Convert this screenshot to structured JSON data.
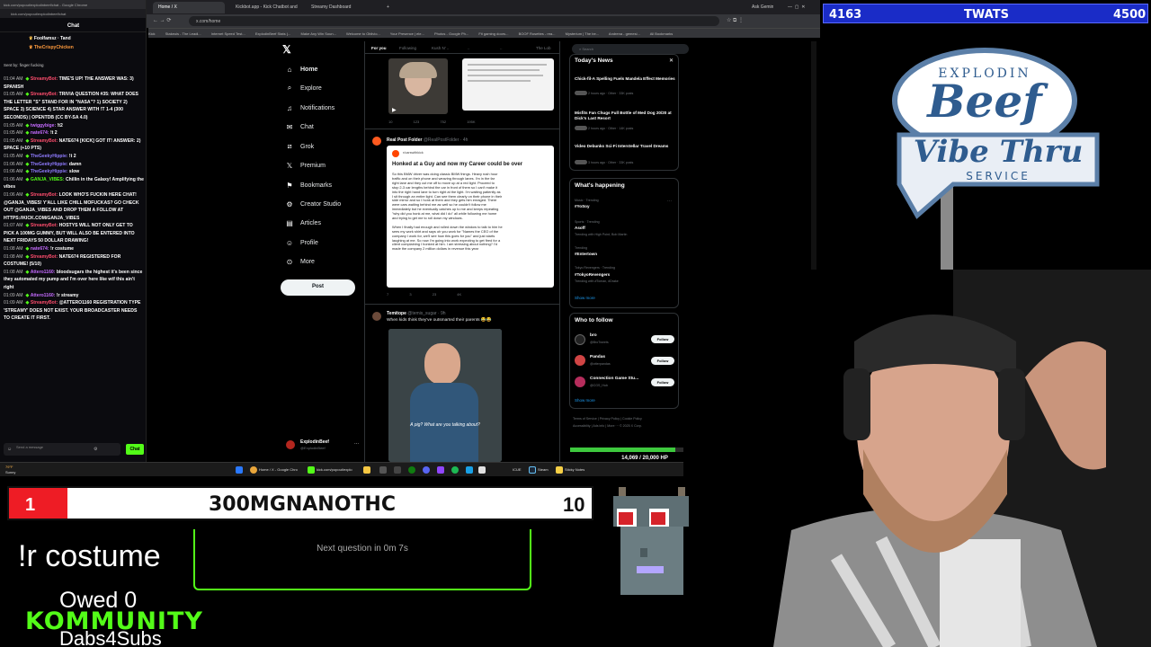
{
  "browser": {
    "tabs": [
      "Home / X",
      "Kickbot.app - Kick Chatbot and",
      "Streamy Dashboard"
    ],
    "url": "x.com/home",
    "bookmarks": [
      "Kick",
      "Stakeuis - The Leadi...",
      "Internet Speed Test...",
      "ExplodinBeef Stats (...",
      "Make Any Win Soun...",
      "Welcome to Oblivio...",
      "Your Presence | ele...",
      "Photos - Google Ph...",
      "Fit gaming doors...",
      "BOOF Rosettes - rea...",
      "Mysterium | The be...",
      "Andrena - gemesi...",
      "All Bookmarks"
    ],
    "gemini_label": "Ask Gemini"
  },
  "chat": {
    "window_title": "kick.com/popout/explodinbeef/chat - Google Chrome",
    "url": "kick.com/popout/explodinbeef/chat",
    "header": "Chat",
    "pinned": [
      {
        "user": "Foolfamsz",
        "text": "Tand"
      },
      {
        "user": "TheCrispyChicken",
        "text": ""
      }
    ],
    "pinned_note": "Sent by: finger fucking",
    "messages": [
      {
        "time": "01:04 AM",
        "user": "StreamyBot:",
        "type": "bot",
        "text": "TIME'S UP! THE ANSWER WAS: 3) SPANISH"
      },
      {
        "time": "01:05 AM",
        "user": "StreamyBot:",
        "type": "bot",
        "text": "TRIVIA QUESTION #35: WHAT DOES THE LETTER \"S\" STAND FOR IN \"NASA\"? 1) SOCIETY 2) SPACE 3) SCIENCE 4) STAR ANSWER WITH !T 1-4 (300 SECONDS) | OPENTDB (CC BY-SA 4.0)"
      },
      {
        "time": "01:05 AM",
        "user": "twiggybige:",
        "type": "user",
        "text": "!t2"
      },
      {
        "time": "01:05 AM",
        "user": "nate674:",
        "type": "user",
        "text": "!t 2"
      },
      {
        "time": "01:05 AM",
        "user": "StreamyBot:",
        "type": "bot",
        "text": "NATE674 [KICK] GOT IT! ANSWER: 2) SPACE (+10 PTS)"
      },
      {
        "time": "01:05 AM",
        "user": "TheGeekyHippie:",
        "type": "cyan",
        "text": "!t 2"
      },
      {
        "time": "01:06 AM",
        "user": "TheGeekyHippie:",
        "type": "cyan",
        "text": "damn"
      },
      {
        "time": "01:06 AM",
        "user": "TheGeekyHippie:",
        "type": "cyan",
        "text": "slow"
      },
      {
        "time": "01:06 AM",
        "user": "GANJA_VIBES:",
        "type": "green",
        "text": "Chillin in the Galaxy! Amplifying the vibes"
      },
      {
        "time": "01:06 AM",
        "user": "StreamyBot:",
        "type": "bot",
        "text": "LOOK WHO'S FUCKIN HERE CHAT! @GANJA_VIBES! Y'ALL LIKE CHILL MOFUCKAS? GO CHECK OUT @GANJA_VIBES AND DROP THEM A FOLLOW AT HTTPS://KICK.COM/GANJA_VIBES"
      },
      {
        "time": "01:07 AM",
        "user": "StreamyBot:",
        "type": "bot",
        "text": "HOSTYS WILL NOT ONLY GET TO PICK A 100MG GUMMY, BUT WILL ALSO BE ENTERED INTO NEXT FRIDAYS 50 DOLLAR DRAWING!"
      },
      {
        "time": "01:08 AM",
        "user": "nate674:",
        "type": "user",
        "text": "!r costume"
      },
      {
        "time": "01:08 AM",
        "user": "StreamyBot:",
        "type": "bot",
        "text": "NATE674 REGISTERED FOR COSTUME! (5/10)"
      },
      {
        "time": "01:08 AM",
        "user": "Attero1160:",
        "type": "user",
        "text": "bloodsugars the highest it's been since they automated my pump and I'm over here like wtf this ain't right"
      },
      {
        "time": "01:09 AM",
        "user": "Attero1160:",
        "type": "user",
        "text": "!r streamy"
      },
      {
        "time": "01:09 AM",
        "user": "StreamyBot:",
        "type": "bot",
        "text": "@ATTERO1160 REGISTRATION TYPE 'STREAMY' DOES NOT EXIST. YOUR BROADCASTER NEEDS TO CREATE IT FIRST."
      }
    ],
    "input_placeholder": "Send a message",
    "send_label": "Chat"
  },
  "x": {
    "nav": [
      "Home",
      "Explore",
      "Notifications",
      "Chat",
      "Grok",
      "Premium",
      "Bookmarks",
      "Creator Studio",
      "Articles",
      "Profile",
      "More"
    ],
    "post_label": "Post",
    "account_name": "ExplodinBeef",
    "account_handle": "@ExplodinBeef",
    "timeline_tabs": [
      "For you",
      "Following",
      "Kush N' ..",
      "..",
      "..",
      "The Lob"
    ],
    "tweet1_actions": [
      "10",
      "123",
      "752",
      "195K"
    ],
    "tweet2": {
      "name": "Real Post Folder",
      "handle": "@RealPostFolder · 4h",
      "image_source": "r/carswithkick",
      "headline": "Honked at a Guy and now my Career could be over",
      "body": [
        "So this BMW driver was doing classic BMW things. Heavy rush hour",
        "traffic and on their phone and weaving through lanes. I'm in the far",
        "right lane and they cut me off to move up at a red light. Proceed to",
        "stop 2-3 car lengths behind the car in front of them so I can't make it",
        "into the right hand lane to turn right at the light. I'm waiting patiently as",
        "I sit through an entire light. Can see them clearly on their phone in their",
        "side mirror and so I honk at them and they gets him enraged. There",
        "were cars waiting behind me as well so he couldn't follow me",
        "immediately but he eventually catches up to me and keeps repeating",
        "\"why did you honk at me, what did I do\" all while following me home",
        "and trying to get me to roll down my windows.",
        "",
        "When I finally had enough and rolled down the window to talk to him he",
        "sees my work shirt and says oh you work for \"Names the CEO of the",
        "company I work for, we'll see how this goes for you\" and just starts",
        "laughing at me. So now I'm going into work expecting to get fired for a",
        "client complaining I honked at him. I am stressing about nothing? I'd",
        "made the company 2 million dollars in revenue this year"
      ],
      "actions": [
        "7",
        "3",
        "23",
        "4K"
      ]
    },
    "tweet3": {
      "name": "Temitope",
      "handle": "@temis_sugar · 9h",
      "text": "When kids think they've outsmarted their parents 😂😂",
      "caption": "A pig? What are you talking about?"
    },
    "search_placeholder": "Search",
    "todays_news": {
      "title": "Today's News",
      "items": [
        {
          "title": "Chick-fil-A Spelling Fuels Mandela Effect Memories",
          "meta": "2 hours ago · Other · 33K posts"
        },
        {
          "title": "Misfits Fan Chugs Full Bottle of Med Dog 20/20 at Dick's Last Resort",
          "meta": "2 hours ago · Other · 14K posts"
        },
        {
          "title": "Video Debunks Sci-Fi Interstellar Travel Dreams",
          "meta": "3 hours ago · Other · 33K posts"
        }
      ]
    },
    "whats_happening": {
      "title": "What's happening",
      "trends": [
        {
          "cat": "Music · Trending",
          "name": "#YoSoy",
          "extra": ""
        },
        {
          "cat": "Sports · Trending",
          "name": "Asoff",
          "extra": "Trending with High Point, Bob Martin"
        },
        {
          "cat": "Trending",
          "name": "#Entertown",
          "extra": ""
        },
        {
          "cat": "Tokyo Revengers · Trending",
          "name": "#TokyoRevengers",
          "extra": "Trending with #Toman, #Drake"
        }
      ],
      "show_more": "Show more"
    },
    "who_to_follow": {
      "title": "Who to follow",
      "accounts": [
        {
          "name": "bro",
          "handle": "@BroTweets"
        },
        {
          "name": "Pandas",
          "handle": "@otterpandas"
        },
        {
          "name": "Connection Game Stu...",
          "handle": "@CGS_Hub"
        }
      ],
      "follow_label": "Follow",
      "show_more": "Show more"
    },
    "footer": [
      "Terms of Service",
      "Privacy Policy",
      "Cookie Policy",
      "Accessibility",
      "Ads info",
      "More ···",
      "© 2025 X Corp."
    ]
  },
  "taskbar": {
    "weather": "79°F",
    "weather_sub": "Sunny",
    "apps": [
      "Home / X - Google Chro",
      "kick.com/popout/explo",
      "ICUE",
      "Steam",
      "Sticky Notes"
    ],
    "time": "1:09 AM",
    "date": "3/22/2026"
  },
  "overlay": {
    "top_left": "4163",
    "top_mid": "TWATS",
    "top_right": "4500",
    "logo_line1": "EXPLODIN",
    "logo_line2": "Beef",
    "logo_line3": "Vibe Thru",
    "logo_line4": "SERVICE",
    "hp_label": "14,069 / 20,000 HP",
    "hp_fraction": 0.703,
    "goal_left": "1",
    "goal_name": "300MGNANOTHC",
    "goal_right": "10",
    "goal_fraction": 0.1,
    "command": "!r costume",
    "trivia_status": "Next question in 0m 7s",
    "owed": "Owed 0",
    "community": "KOMMUNITY",
    "dabs": "Dabs4Subs"
  }
}
